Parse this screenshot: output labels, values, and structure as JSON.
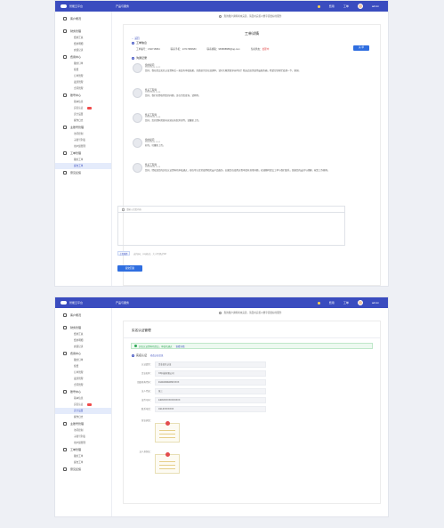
{
  "app": {
    "title": "智能云平台",
    "top_menu": "产品与服务",
    "right_items": [
      "费用",
      "工单"
    ],
    "username": "admin"
  },
  "sidebar": {
    "home": "客户概况",
    "groups": [
      {
        "label": "财务管理",
        "items": [
          "费用汇总",
          "费用明细",
          "充值记录"
        ]
      },
      {
        "label": "费用中心",
        "items": [
          "我的订单",
          "续费",
          "订单管理",
          "发票管理",
          "合同管理"
        ]
      },
      {
        "label": "账号中心",
        "items": [
          "基本信息",
          "实名认证",
          "安全设置",
          "操作日志"
        ]
      },
      {
        "label": "主账号管理",
        "items": [
          "访问控制",
          "子账号列表",
          "用户组管理"
        ]
      },
      {
        "label": "工单管理",
        "items": [
          "我的工单",
          "提交工单"
        ]
      },
      {
        "label": "意见反馈",
        "items": []
      }
    ]
  },
  "notice": "您的账户资料尚未完善，请及时完善以便享受更好的服务",
  "ticket": {
    "page_title": "工单详情",
    "back": "返回",
    "section_info": "工单信息",
    "ticket_no_label": "工单编号：",
    "ticket_no": "CS0715864",
    "phone_label": "联系手机：",
    "phone": "13717980680",
    "email_label": "联系邮箱：",
    "email": "965888888@qq.com",
    "status_label": "当前状态：",
    "status": "处理中",
    "close_btn": "关 单",
    "section_records": "沟通记录",
    "records": [
      {
        "name": "您的提问",
        "time": "2019-03-06 10:22",
        "text": "您好，我在提交实名认证资料后一直没有审核结果，页面显示正在处理中，请问大概需要多长时间？我这边急需使用云服务器，希望尽快帮忙处理一下，谢谢。"
      },
      {
        "name": "售后工程师",
        "time": "2019-03-06 10:36",
        "text": "您好，我们已经收到您的问题，正在为您查询，请稍等。"
      },
      {
        "name": "售后工程师",
        "time": "2019-03-06 10:48",
        "text": "您好，您的资料需要补充营业执照复印件，请重新上传。"
      },
      {
        "name": "您的提问",
        "time": "2019-03-06 11:02",
        "text": "好的，已重新上传。"
      },
      {
        "name": "售后工程师",
        "time": "2019-03-06 11:20",
        "text": "您好，经核查您的实名认证资料已审核通过，现在可以正常使用相关云产品服务。如果您在使用过程中还有其他问题，欢迎随时提交工单与我们联系，感谢您的支持与理解，祝您工作顺利。"
      }
    ],
    "editor_placeholder": "请输入回复内容",
    "attach_btn": "上传附件",
    "attach_hint": "支持jpg、png格式，大小不超过5M",
    "submit_btn": "提交回复"
  },
  "verify": {
    "page_title": "实名认证管理",
    "success_text": "实名认证资料已提交，审核已通过",
    "success_link": "查看详情",
    "section": "实名认证",
    "section_link": "修改认证信息",
    "fields": [
      {
        "label": "认证类型：",
        "value": "企业实名认证"
      },
      {
        "label": "企业名称：",
        "value": "XX科技有限公司"
      },
      {
        "label": "组织机构代码：",
        "value": "91440300MA5FXXXX"
      },
      {
        "label": "法人代表：",
        "value": "张三"
      },
      {
        "label": "证件号码：",
        "value": "4403XXXXXXXXXXXX"
      },
      {
        "label": "联系电话：",
        "value": "010-6XXXXXXX"
      }
    ],
    "img1_label": "营业执照：",
    "img2_label": "法人身份证："
  }
}
